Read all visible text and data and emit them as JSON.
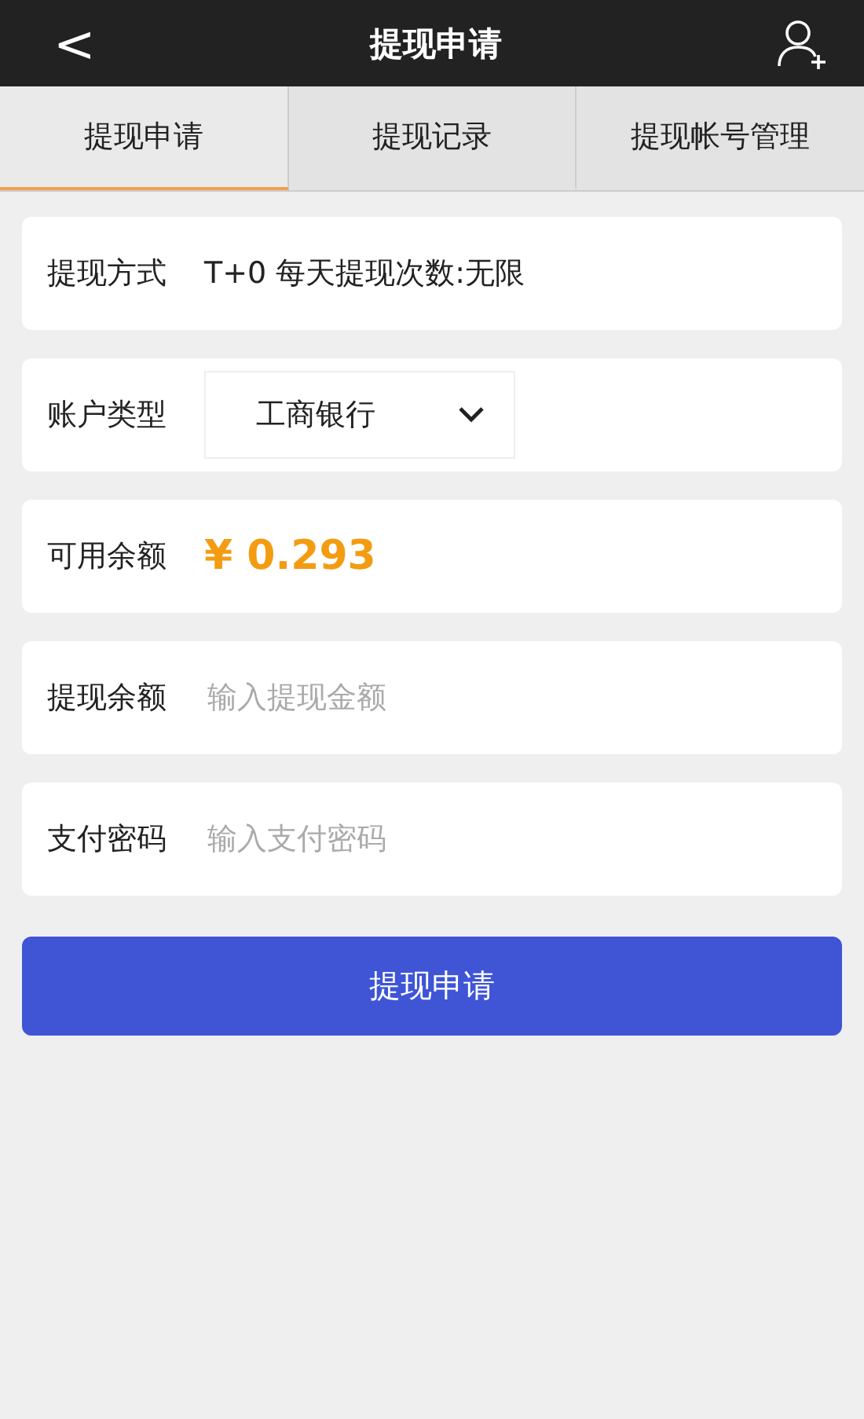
{
  "header": {
    "back": "<",
    "title": "提现申请"
  },
  "tabs": [
    {
      "label": "提现申请",
      "selected": true
    },
    {
      "label": "提现记录",
      "selected": false
    },
    {
      "label": "提现帐号管理",
      "selected": false
    }
  ],
  "rows": [
    {
      "kind": "text",
      "label": "提现方式",
      "value": "T+0 每天提现次数:无限"
    },
    {
      "kind": "select",
      "label": "账户类型",
      "value": "工商银行"
    },
    {
      "kind": "amount",
      "label": "可用余额",
      "value": "¥ 0.293"
    },
    {
      "kind": "input",
      "label": "提现余额",
      "placeholder": "输入提现金额"
    },
    {
      "kind": "input",
      "label": "支付密码",
      "placeholder": "输入支付密码"
    }
  ],
  "submit": "提现申请"
}
